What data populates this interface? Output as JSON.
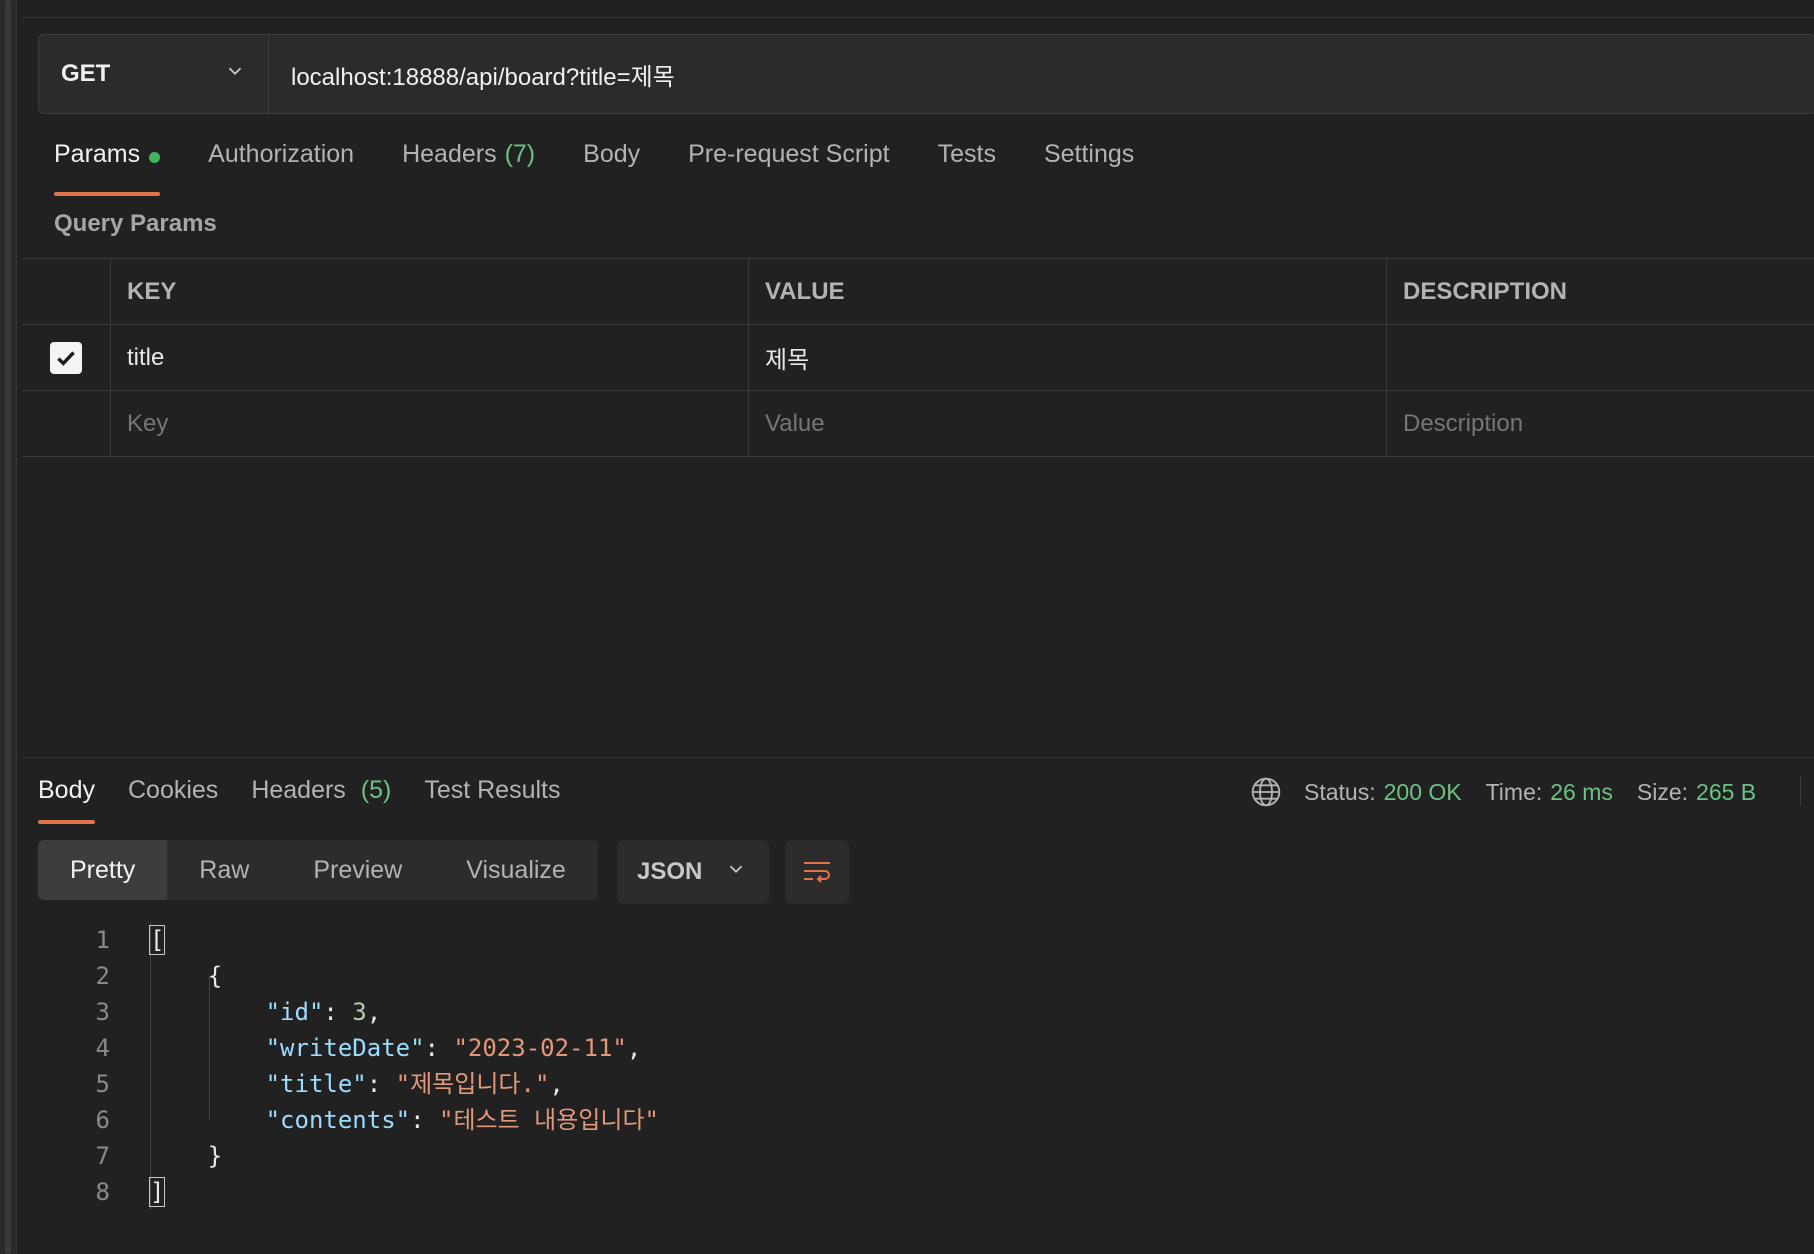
{
  "request": {
    "method": "GET",
    "url": "localhost:18888/api/board?title=제목"
  },
  "tabs": [
    {
      "label": "Params",
      "count": "",
      "active": true
    },
    {
      "label": "Authorization",
      "count": ""
    },
    {
      "label": "Headers",
      "count": "(7)"
    },
    {
      "label": "Body",
      "count": ""
    },
    {
      "label": "Pre-request Script",
      "count": ""
    },
    {
      "label": "Tests",
      "count": ""
    },
    {
      "label": "Settings",
      "count": ""
    }
  ],
  "query_params": {
    "title": "Query Params",
    "columns": [
      "KEY",
      "VALUE",
      "DESCRIPTION"
    ],
    "rows": [
      {
        "checked": true,
        "key": "title",
        "value": "제목",
        "description": ""
      }
    ],
    "placeholders": {
      "key": "Key",
      "value": "Value",
      "description": "Description"
    }
  },
  "response": {
    "tabs": [
      {
        "label": "Body",
        "count": "",
        "active": true
      },
      {
        "label": "Cookies",
        "count": ""
      },
      {
        "label": "Headers",
        "count": "(5)"
      },
      {
        "label": "Test Results",
        "count": ""
      }
    ],
    "status": {
      "status_label": "Status:",
      "status_value": "200 OK",
      "time_label": "Time:",
      "time_value": "26 ms",
      "size_label": "Size:",
      "size_value": "265 B"
    },
    "view_modes": [
      "Pretty",
      "Raw",
      "Preview",
      "Visualize"
    ],
    "active_view": "Pretty",
    "format": "JSON",
    "body_lines": [
      "1",
      "2",
      "3",
      "4",
      "5",
      "6",
      "7",
      "8"
    ],
    "body": {
      "open_bracket": "[",
      "open_brace": "{",
      "id_key": "\"id\"",
      "id_value": "3",
      "writeDate_key": "\"writeDate\"",
      "writeDate_value": "\"2023-02-11\"",
      "title_key": "\"title\"",
      "title_value": "\"제목입니다.\"",
      "contents_key": "\"contents\"",
      "contents_value": "\"테스트 내용입니다\"",
      "close_brace": "}",
      "close_bracket": "]"
    }
  },
  "colors": {
    "accent": "#e0744a",
    "success": "#6bc283",
    "background": "#212121"
  }
}
